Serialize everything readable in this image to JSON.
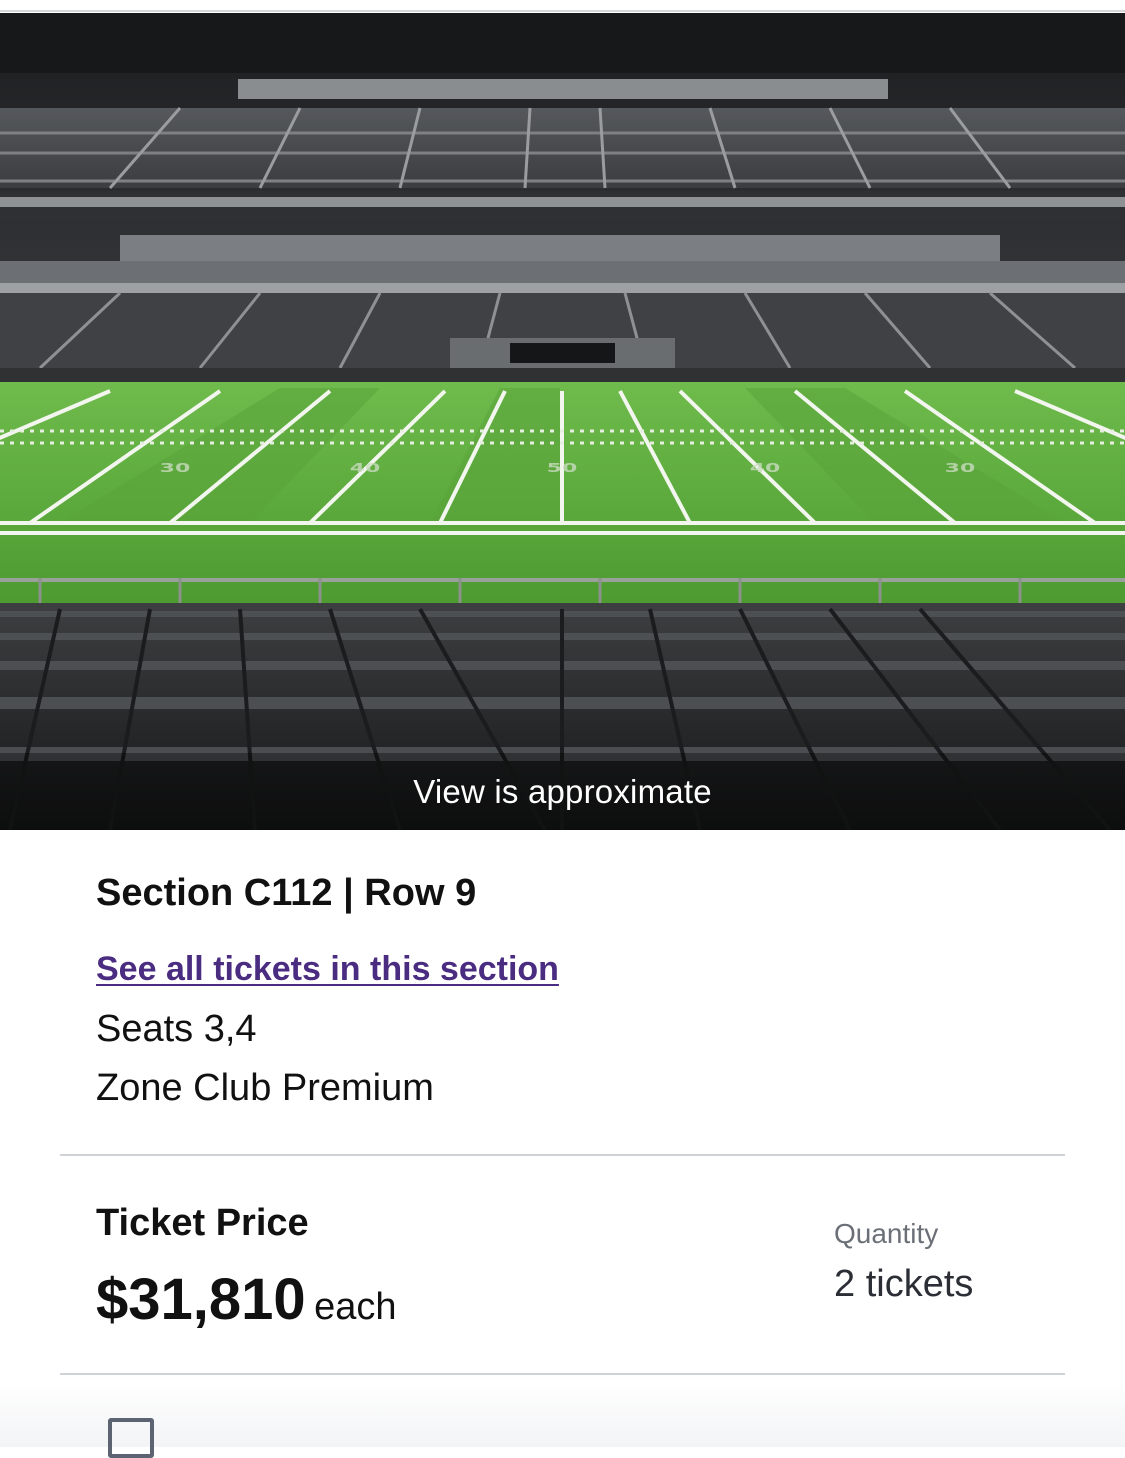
{
  "hero": {
    "caption": "View is approximate",
    "field_numbers": [
      "30",
      "40",
      "50",
      "40",
      "30"
    ]
  },
  "listing": {
    "section_row": "Section C112 | Row 9",
    "see_all_link": "See all tickets in this section",
    "seats": "Seats 3,4",
    "zone": "Zone Club Premium"
  },
  "price": {
    "title": "Ticket Price",
    "amount": "$31,810",
    "unit": "each"
  },
  "quantity": {
    "label": "Quantity",
    "value": "2 tickets"
  },
  "colors": {
    "link": "#4a2c80",
    "turf": "#5aa43a",
    "divider": "#cfd3d7"
  }
}
